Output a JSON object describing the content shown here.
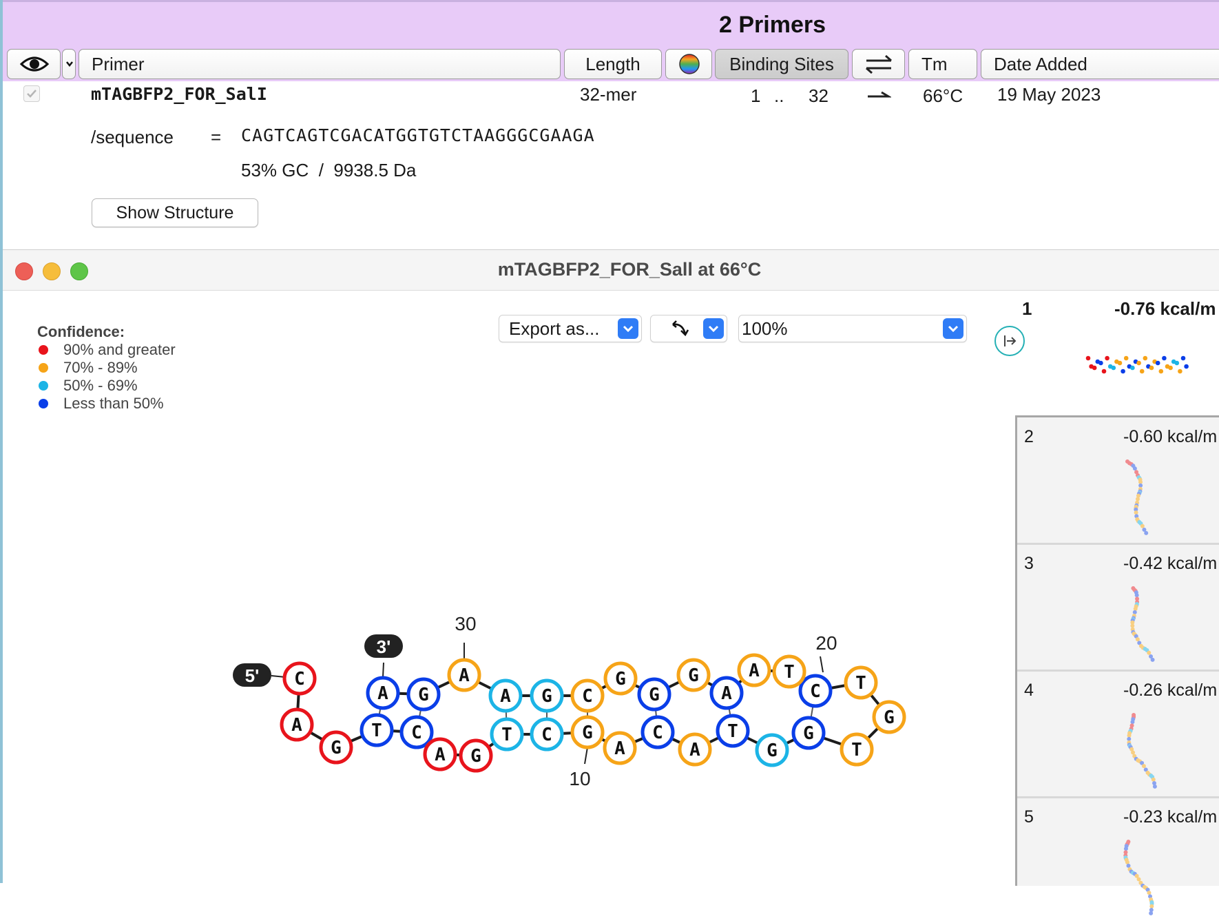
{
  "header": {
    "title": "2 Primers",
    "columns": {
      "primer": "Primer",
      "length": "Length",
      "binding_sites": "Binding Sites",
      "tm": "Tm",
      "date_added": "Date Added"
    }
  },
  "primer": {
    "name": "mTAGBFP2_FOR_SalI",
    "length": "32-mer",
    "site_start": "1",
    "site_sep": "..",
    "site_end": "32",
    "tm": "66°C",
    "date": "19 May 2023",
    "sequence_label": "/sequence",
    "equals": "=",
    "sequence": "CAGTCAGTCGACATGGTGTCTAAGGGCGAAGA",
    "stats": "53% GC  /  9938.5 Da",
    "show_structure": "Show Structure"
  },
  "structure_window": {
    "title": "mTAGBFP2_FOR_Sall at 66°C",
    "legend": {
      "title": "Confidence:",
      "items": [
        "90% and greater",
        "70% - 89%",
        "50% - 69%",
        "Less than 50%"
      ],
      "colors": [
        "#e8141c",
        "#f6a418",
        "#1cb4e6",
        "#0a3ee8"
      ]
    },
    "export_label": "Export as...",
    "zoom": "100%",
    "end_labels": {
      "five": "5'",
      "three": "3'"
    },
    "position_labels": {
      "p10": "10",
      "p20": "20",
      "p30": "30"
    }
  },
  "structures": [
    {
      "rank": "1",
      "energy": "-0.76 kcal/m"
    },
    {
      "rank": "2",
      "energy": "-0.60 kcal/m"
    },
    {
      "rank": "3",
      "energy": "-0.42 kcal/m"
    },
    {
      "rank": "4",
      "energy": "-0.26 kcal/m"
    },
    {
      "rank": "5",
      "energy": "-0.23 kcal/m"
    }
  ],
  "nodes": [
    {
      "b": "C",
      "c": "red"
    },
    {
      "b": "A",
      "c": "red"
    },
    {
      "b": "G",
      "c": "red"
    },
    {
      "b": "T",
      "c": "blue"
    },
    {
      "b": "C",
      "c": "blue"
    },
    {
      "b": "A",
      "c": "red"
    },
    {
      "b": "G",
      "c": "red"
    },
    {
      "b": "T",
      "c": "cyan"
    },
    {
      "b": "C",
      "c": "cyan"
    },
    {
      "b": "G",
      "c": "orange"
    },
    {
      "b": "A",
      "c": "orange"
    },
    {
      "b": "C",
      "c": "blue"
    },
    {
      "b": "A",
      "c": "orange"
    },
    {
      "b": "T",
      "c": "blue"
    },
    {
      "b": "G",
      "c": "cyan"
    },
    {
      "b": "G",
      "c": "blue"
    },
    {
      "b": "T",
      "c": "orange"
    },
    {
      "b": "G",
      "c": "orange"
    },
    {
      "b": "T",
      "c": "orange"
    },
    {
      "b": "C",
      "c": "blue"
    },
    {
      "b": "T",
      "c": "orange"
    },
    {
      "b": "A",
      "c": "orange"
    },
    {
      "b": "A",
      "c": "blue"
    },
    {
      "b": "G",
      "c": "orange"
    },
    {
      "b": "G",
      "c": "blue"
    },
    {
      "b": "G",
      "c": "orange"
    },
    {
      "b": "C",
      "c": "orange"
    },
    {
      "b": "G",
      "c": "cyan"
    },
    {
      "b": "A",
      "c": "cyan"
    },
    {
      "b": "A",
      "c": "orange"
    },
    {
      "b": "G",
      "c": "blue"
    },
    {
      "b": "A",
      "c": "blue"
    }
  ]
}
